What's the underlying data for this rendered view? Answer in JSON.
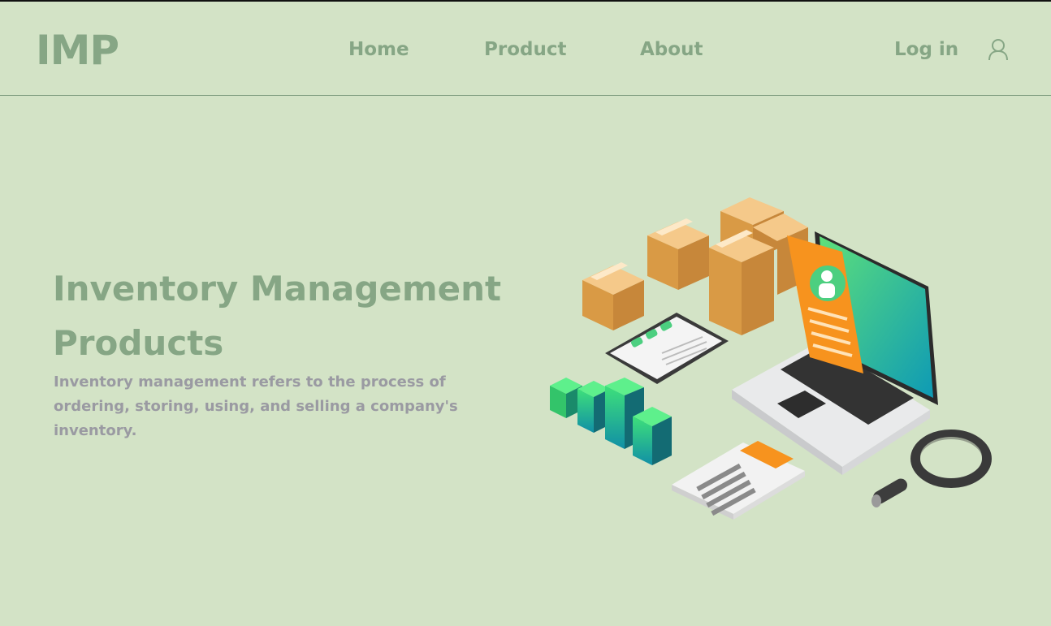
{
  "brand": {
    "logo": "IMP"
  },
  "nav": {
    "items": [
      {
        "label": "Home"
      },
      {
        "label": "Product"
      },
      {
        "label": "About"
      }
    ],
    "login_label": "Log in",
    "user_icon": "user-icon"
  },
  "hero": {
    "title": "Inventory Management Products",
    "description": "Inventory management refers to the process of ordering, storing, using, and selling a company's inventory."
  },
  "illustration": {
    "subject": "inventory-illustration",
    "elements": [
      "boxes",
      "laptop",
      "document",
      "clipboard",
      "bar-blocks",
      "calculator",
      "magnifier"
    ]
  },
  "colors": {
    "background": "#d3e3c6",
    "brand_green": "#86a685",
    "text_gray": "#9a9aa2",
    "divider": "#7f9c80"
  }
}
